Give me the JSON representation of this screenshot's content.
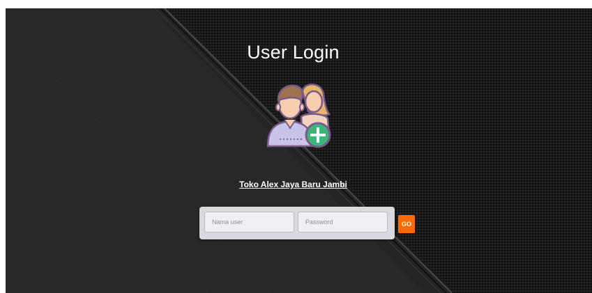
{
  "page": {
    "title": "User Login",
    "store_name": "Toko Alex Jaya Baru Jambi"
  },
  "login_form": {
    "username_placeholder": "Nama user",
    "password_placeholder": "Password",
    "submit_label": "GO"
  },
  "icons": {
    "avatar": "add-user-icon"
  },
  "colors": {
    "background": "#1a1a1a",
    "go_button": "#ff6a00",
    "form_panel": "#d9dadf",
    "title_text": "#ffffff"
  }
}
